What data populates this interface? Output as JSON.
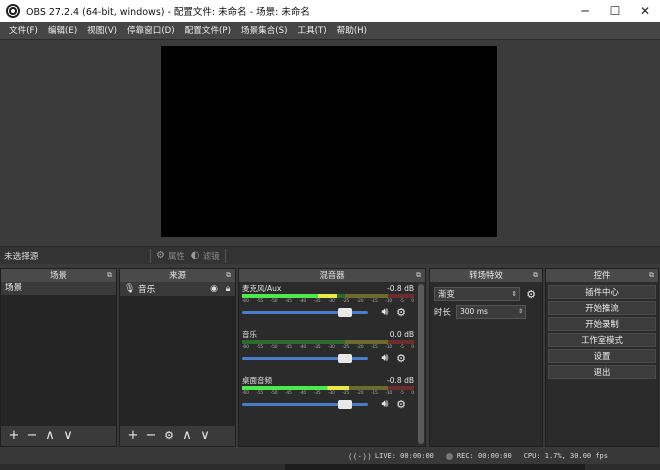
{
  "window": {
    "title": "OBS 27.2.4 (64-bit, windows) - 配置文件: 未命名 - 场景: 未命名"
  },
  "menu": [
    "文件(F)",
    "编辑(E)",
    "视图(V)",
    "停靠窗口(D)",
    "配置文件(P)",
    "场景集合(S)",
    "工具(T)",
    "帮助(H)"
  ],
  "source_toolbar": {
    "no_selection": "未选择源",
    "properties": "属性",
    "filters": "滤镜"
  },
  "docks": {
    "scenes": {
      "title": "场景",
      "items": [
        "场景"
      ]
    },
    "sources": {
      "title": "来源",
      "items": [
        "音乐"
      ]
    },
    "mixer": {
      "title": "混音器",
      "channels": [
        {
          "name": "麦克风/Aux",
          "db": "-0.8 dB",
          "level": 0.55,
          "volume": 0.86
        },
        {
          "name": "音乐",
          "db": "0.0 dB",
          "level": 0.0,
          "volume": 0.86
        },
        {
          "name": "桌面音频",
          "db": "-0.8 dB",
          "level": 0.62,
          "volume": 0.86
        }
      ],
      "ticks": [
        "-60",
        "-55",
        "-50",
        "-45",
        "-40",
        "-35",
        "-30",
        "-25",
        "-20",
        "-15",
        "-10",
        "-5",
        "0"
      ]
    },
    "transitions": {
      "title": "转场特效",
      "selected": "渐变",
      "duration_label": "时长",
      "duration_value": "300 ms"
    },
    "controls": {
      "title": "控件",
      "buttons": [
        "插件中心",
        "开始推流",
        "开始录制",
        "工作室模式",
        "设置",
        "退出"
      ]
    }
  },
  "status": {
    "live": "LIVE: 00:00:00",
    "rec": "REC: 00:00:00",
    "cpu": "CPU: 1.7%, 30.00 fps"
  },
  "icons": {
    "mic": "mic-icon",
    "eye": "eye-icon",
    "lock": "lock-icon",
    "gear": "gear-icon",
    "speaker": "speaker-icon",
    "add": "add-icon",
    "remove": "remove-icon",
    "up": "chevron-up-icon",
    "down": "chevron-down-icon"
  }
}
